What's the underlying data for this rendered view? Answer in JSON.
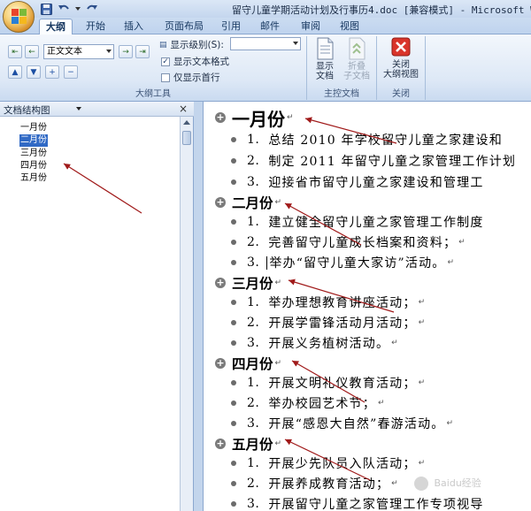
{
  "window": {
    "title": "留守儿童学期活动计划及行事历4.doc [兼容模式] - Microsoft Wo"
  },
  "quick_access": {
    "icons": [
      "save-icon",
      "undo-icon",
      "redo-icon"
    ]
  },
  "ribbon": {
    "tabs": [
      {
        "label": "大纲",
        "active": true
      },
      {
        "label": "开始"
      },
      {
        "label": "插入"
      },
      {
        "label": "页面布局"
      },
      {
        "label": "引用"
      },
      {
        "label": "邮件"
      },
      {
        "label": "审阅"
      },
      {
        "label": "视图"
      }
    ],
    "outline_tools": {
      "group_label": "大纲工具",
      "level_combo_value": "正文文本",
      "show_level_label": "显示级别(S):",
      "show_level_value": "",
      "show_text_format_label": "显示文本格式",
      "show_text_format_checked": true,
      "first_line_only_label": "仅显示首行",
      "first_line_only_checked": false
    },
    "master_document": {
      "group_label": "主控文档",
      "show_document_label": "显示\n文档",
      "collapse_subdocuments_label": "折叠\n子文档"
    },
    "close": {
      "group_label": "关闭",
      "close_outline_label": "关闭\n大纲视图"
    }
  },
  "nav_pane": {
    "title": "文档结构图",
    "close_glyph": "×",
    "items": [
      {
        "label": "一月份"
      },
      {
        "label": "二月份",
        "selected": true
      },
      {
        "label": "三月份"
      },
      {
        "label": "四月份"
      },
      {
        "label": "五月份"
      }
    ]
  },
  "document": {
    "sections": [
      {
        "heading": "一月份",
        "items": [
          {
            "num": "1.",
            "text": "总结 2010 年学校留守儿童之家建设和"
          },
          {
            "num": "2.",
            "text": "制定 2011 年留守儿童之家管理工作计划"
          },
          {
            "num": "3.",
            "text": "迎接省市留守儿童之家建设和管理工"
          }
        ]
      },
      {
        "heading": "二月份",
        "items": [
          {
            "num": "1.",
            "text": "建立健全留守儿童之家管理工作制度"
          },
          {
            "num": "2.",
            "text": "完善留守儿童成长档案和资料；"
          },
          {
            "num": "3.",
            "text": "举办“留守儿童大家访”活动。"
          }
        ]
      },
      {
        "heading": "三月份",
        "items": [
          {
            "num": "1.",
            "text": "举办理想教育讲座活动；"
          },
          {
            "num": "2.",
            "text": "开展学雷锋活动月活动；"
          },
          {
            "num": "3.",
            "text": "开展义务植树活动。"
          }
        ]
      },
      {
        "heading": "四月份",
        "items": [
          {
            "num": "1.",
            "text": "开展文明礼仪教育活动；"
          },
          {
            "num": "2.",
            "text": "举办校园艺术节；"
          },
          {
            "num": "3.",
            "text": "开展“感恩大自然”春游活动。"
          }
        ]
      },
      {
        "heading": "五月份",
        "items": [
          {
            "num": "1.",
            "text": "开展少先队员入队活动；"
          },
          {
            "num": "2.",
            "text": "开展养成教育活动；"
          },
          {
            "num": "3.",
            "text": "开展留守儿童之家管理工作专项视导"
          }
        ]
      }
    ],
    "paragraph_mark": "↵"
  },
  "watermark": {
    "text": "Baidu经验"
  },
  "colors": {
    "arrow": "#a01a1a",
    "selection": "#316ac5"
  }
}
